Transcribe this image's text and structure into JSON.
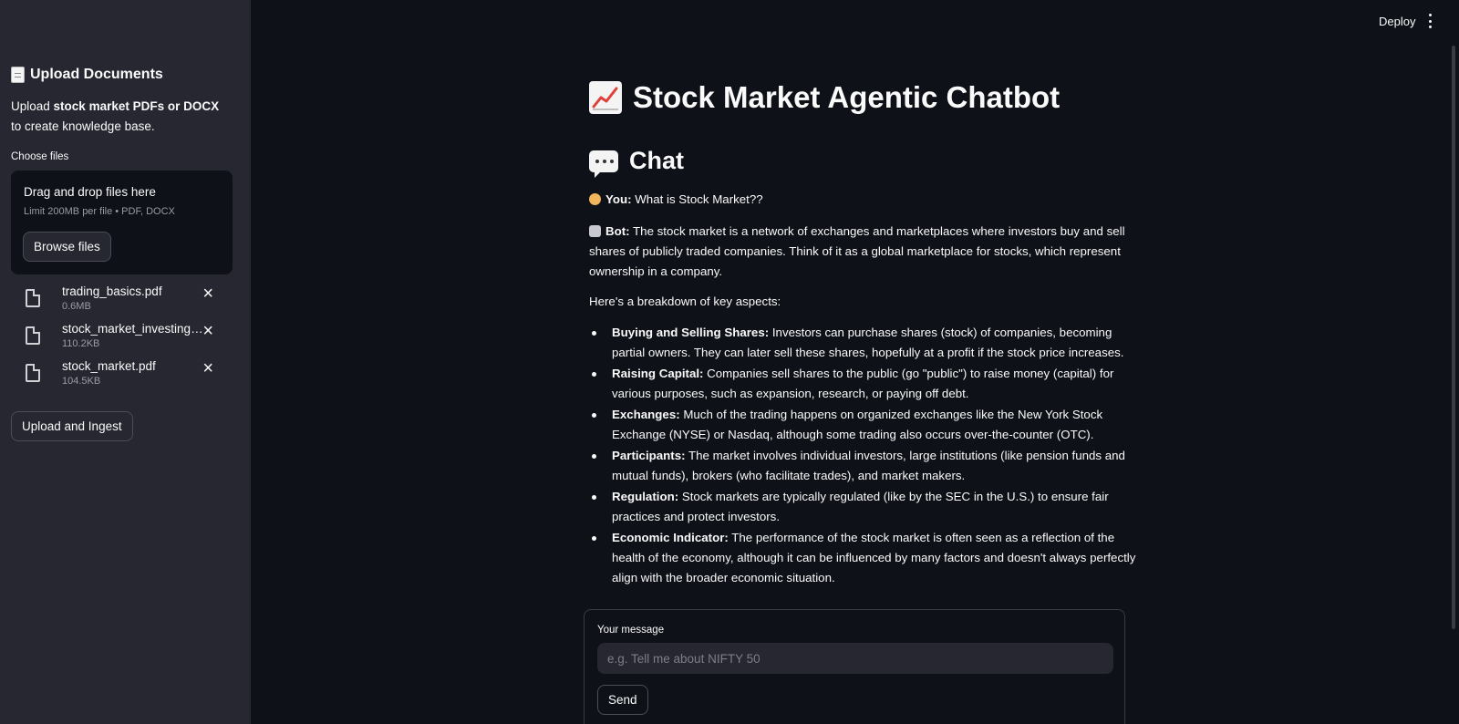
{
  "sidebar": {
    "header": "Upload Documents",
    "desc_prefix": "Upload ",
    "desc_bold": "stock market PDFs or DOCX",
    "desc_suffix": " to create knowledge base.",
    "choose_label": "Choose files",
    "dropzone": {
      "title": "Drag and drop files here",
      "limit": "Limit 200MB per file • PDF, DOCX",
      "browse_label": "Browse files"
    },
    "files": [
      {
        "name": "trading_basics.pdf",
        "size": "0.6MB"
      },
      {
        "name": "stock_market_investing_…",
        "size": "110.2KB"
      },
      {
        "name": "stock_market.pdf",
        "size": "104.5KB"
      }
    ],
    "upload_label": "Upload and Ingest"
  },
  "topbar": {
    "deploy_label": "Deploy"
  },
  "main": {
    "title": "Stock Market Agentic Chatbot",
    "chat_heading": "Chat",
    "user_label": "You:",
    "user_message": " What is Stock Market??",
    "bot_label": "Bot:",
    "bot_message": " The stock market is a network of exchanges and marketplaces where investors buy and sell shares of publicly traded companies. Think of it as a global marketplace for stocks, which represent ownership in a company.",
    "breakdown": "Here's a breakdown of key aspects:",
    "bullets": [
      {
        "term": "Buying and Selling Shares:",
        "text": " Investors can purchase shares (stock) of companies, becoming partial owners. They can later sell these shares, hopefully at a profit if the stock price increases."
      },
      {
        "term": "Raising Capital:",
        "text": " Companies sell shares to the public (go \"public\") to raise money (capital) for various purposes, such as expansion, research, or paying off debt."
      },
      {
        "term": "Exchanges:",
        "text": " Much of the trading happens on organized exchanges like the New York Stock Exchange (NYSE) or Nasdaq, although some trading also occurs over-the-counter (OTC)."
      },
      {
        "term": "Participants:",
        "text": " The market involves individual investors, large institutions (like pension funds and mutual funds), brokers (who facilitate trades), and market makers."
      },
      {
        "term": "Regulation:",
        "text": " Stock markets are typically regulated (like by the SEC in the U.S.) to ensure fair practices and protect investors."
      },
      {
        "term": "Economic Indicator:",
        "text": " The performance of the stock market is often seen as a reflection of the health of the economy, although it can be influenced by many factors and doesn't always perfectly align with the broader economic situation."
      }
    ]
  },
  "form": {
    "label": "Your message",
    "placeholder": "e.g. Tell me about NIFTY 50",
    "value": "",
    "send_label": "Send"
  }
}
